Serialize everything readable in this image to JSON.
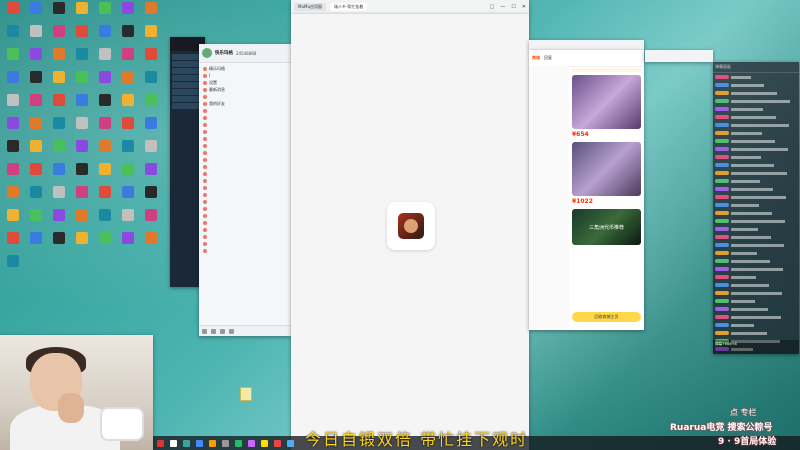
{
  "desktop": {
    "icons": [
      "",
      "",
      "",
      "",
      "",
      "",
      "",
      "",
      "",
      "",
      "",
      "",
      "",
      "",
      "",
      "",
      "",
      "",
      "",
      "",
      "",
      "",
      "",
      "",
      "",
      "",
      "",
      "",
      "",
      "",
      "",
      "",
      "",
      "",
      "",
      "",
      "",
      "",
      "",
      "",
      "",
      "",
      "",
      "",
      "",
      "",
      "",
      "",
      "",
      "",
      "",
      "",
      "",
      "",
      "",
      "",
      "",
      "",
      "",
      "",
      "",
      "",
      "",
      "",
      "",
      "",
      "",
      "",
      "",
      "",
      "",
      "",
      "",
      "",
      "",
      "",
      "",
      ""
    ],
    "file_label": ""
  },
  "browser_tabs": {
    "tab1": "MuMu应用窗",
    "tab2": "瑞人乡·帮忙挂着",
    "controls": [
      "□",
      "—",
      "☐",
      "✕"
    ]
  },
  "qq": {
    "name": "快乐玛格",
    "id": "24548888",
    "groups": [
      "精乐玛格",
      "Ⅰ",
      "设置",
      "最新消息",
      "",
      "我的好友",
      "",
      "",
      "",
      "",
      "",
      "",
      "",
      "",
      "",
      "",
      "",
      "",
      "",
      "",
      "",
      "",
      "",
      "",
      "",
      "",
      ""
    ]
  },
  "shop": {
    "tabs": [
      "商城",
      "回复"
    ],
    "notice": "",
    "products": [
      {
        "title": "",
        "price": "¥654",
        "sold": ""
      },
      {
        "title": "",
        "price": "¥1022",
        "sold": ""
      },
      {
        "title": "三角洲代币推荐",
        "price": "",
        "sold": ""
      }
    ],
    "button": "回收商城主页"
  },
  "chat": {
    "header": "弹幕面板",
    "bottom": "弹幕+666+8"
  },
  "subtitle": "今日自锻双倍 带忙挂下观时",
  "watermark": {
    "line1": "点 专栏",
    "line2": "Ruarua电竞 搜索公粽号",
    "line3": "9 · 9首局体验"
  },
  "colors": {
    "accent_orange": "#ff5000",
    "price_red": "#ff2a00",
    "subtitle_yellow": "#ffd41a"
  }
}
